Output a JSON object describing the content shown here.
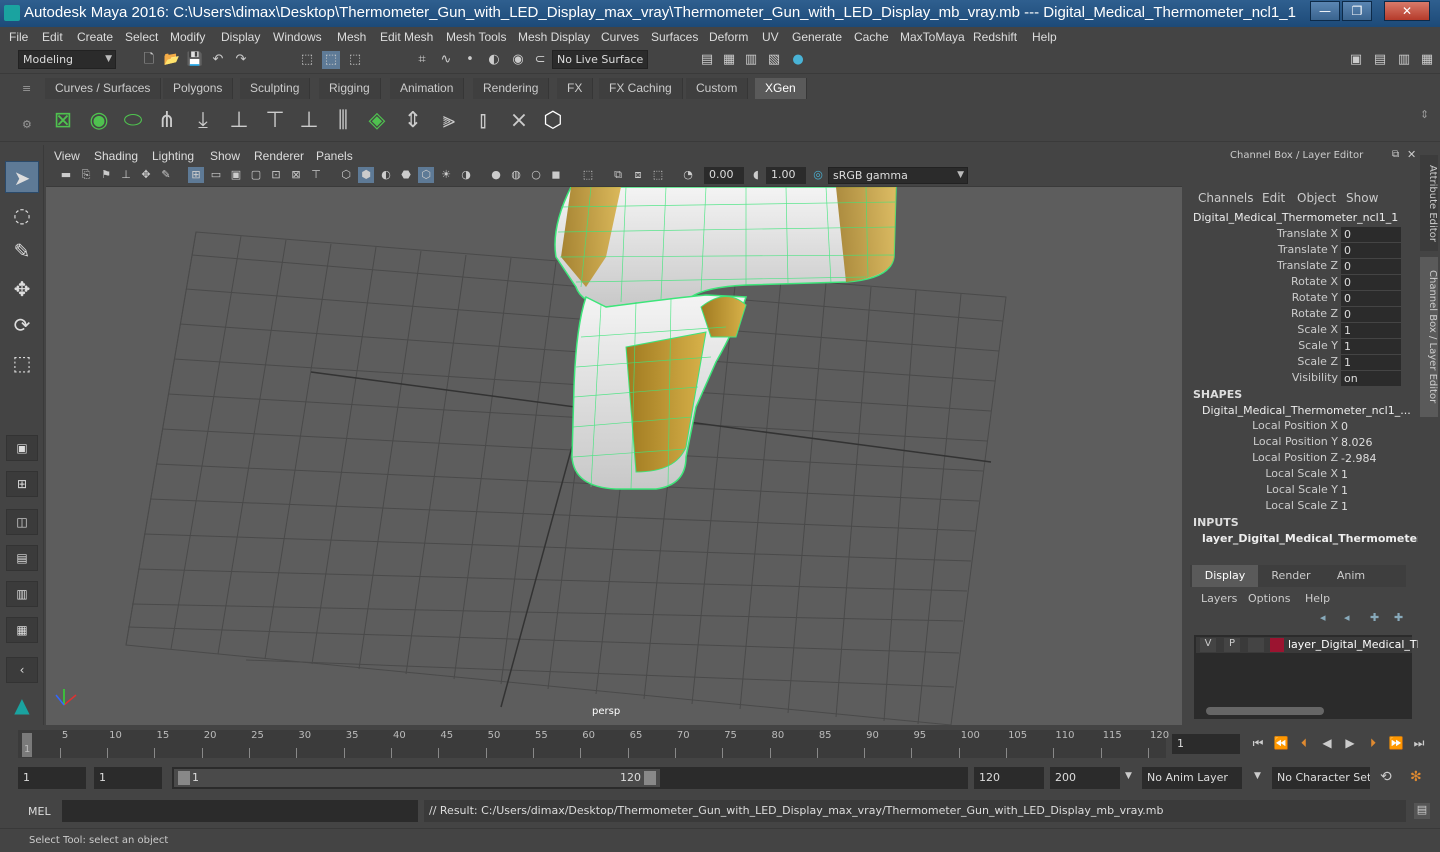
{
  "window": {
    "title": "Autodesk Maya 2016: C:\\Users\\dimax\\Desktop\\Thermometer_Gun_with_LED_Display_max_vray\\Thermometer_Gun_with_LED_Display_mb_vray.mb   ---   Digital_Medical_Thermometer_ncl1_1",
    "minimize": "—",
    "maximize": "❐",
    "close": "✕"
  },
  "menu": [
    "File",
    "Edit",
    "Create",
    "Select",
    "Modify",
    "Display",
    "Windows",
    "Mesh",
    "Edit Mesh",
    "Mesh Tools",
    "Mesh Display",
    "Curves",
    "Surfaces",
    "Deform",
    "UV",
    "Generate",
    "Cache",
    "MaxToMaya",
    "Redshift",
    "Help"
  ],
  "status": {
    "mode": "Modeling",
    "live_surface": "No Live Surface"
  },
  "shelf_tabs": [
    "Curves / Surfaces",
    "Polygons",
    "Sculpting",
    "Rigging",
    "Animation",
    "Rendering",
    "FX",
    "FX Caching",
    "Custom",
    "XGen"
  ],
  "active_shelf_tab": "XGen",
  "viewport": {
    "menus": [
      "View",
      "Shading",
      "Lighting",
      "Show",
      "Renderer",
      "Panels"
    ],
    "exposure": "0.00",
    "gamma": "1.00",
    "color_space": "sRGB gamma",
    "camera_label": "persp"
  },
  "channel_box": {
    "header": "Channel Box / Layer Editor",
    "menus": [
      "Channels",
      "Edit",
      "Object",
      "Show"
    ],
    "object_name": "Digital_Medical_Thermometer_ncl1_1",
    "attrs": [
      {
        "label": "Translate X",
        "value": "0"
      },
      {
        "label": "Translate Y",
        "value": "0"
      },
      {
        "label": "Translate Z",
        "value": "0"
      },
      {
        "label": "Rotate X",
        "value": "0"
      },
      {
        "label": "Rotate Y",
        "value": "0"
      },
      {
        "label": "Rotate Z",
        "value": "0"
      },
      {
        "label": "Scale X",
        "value": "1"
      },
      {
        "label": "Scale Y",
        "value": "1"
      },
      {
        "label": "Scale Z",
        "value": "1"
      },
      {
        "label": "Visibility",
        "value": "on"
      }
    ],
    "shapes_title": "SHAPES",
    "shape_name": "Digital_Medical_Thermometer_ncl1_...",
    "shape_attrs": [
      {
        "label": "Local Position X",
        "value": "0"
      },
      {
        "label": "Local Position Y",
        "value": "8.026"
      },
      {
        "label": "Local Position Z",
        "value": "-2.984"
      },
      {
        "label": "Local Scale X",
        "value": "1"
      },
      {
        "label": "Local Scale Y",
        "value": "1"
      },
      {
        "label": "Local Scale Z",
        "value": "1"
      }
    ],
    "inputs_title": "INPUTS",
    "input_name": "layer_Digital_Medical_Thermometer"
  },
  "layer_editor": {
    "tabs": [
      "Display",
      "Render",
      "Anim"
    ],
    "menus": [
      "Layers",
      "Options",
      "Help"
    ],
    "layer": {
      "v": "V",
      "p": "P",
      "name": "layer_Digital_Medical_Th",
      "color": "#9b1430"
    }
  },
  "side_tabs": [
    "Attribute Editor",
    "Channel Box / Layer Editor"
  ],
  "timeline": {
    "ticks": [
      "5",
      "10",
      "15",
      "20",
      "25",
      "30",
      "35",
      "40",
      "45",
      "50",
      "55",
      "60",
      "65",
      "70",
      "75",
      "80",
      "85",
      "90",
      "95",
      "100",
      "105",
      "110",
      "115",
      "120"
    ],
    "current": "1",
    "current_frame_field": "1"
  },
  "range": {
    "start": "1",
    "start2": "1",
    "slider_start": "1",
    "slider_end": "120",
    "end": "120",
    "end2": "200",
    "anim_layer": "No Anim Layer",
    "char_set": "No Character Set"
  },
  "command": {
    "label": "MEL",
    "result": "// Result: C:/Users/dimax/Desktop/Thermometer_Gun_with_LED_Display_max_vray/Thermometer_Gun_with_LED_Display_mb_vray.mb"
  },
  "help_line": "Select Tool: select an object"
}
